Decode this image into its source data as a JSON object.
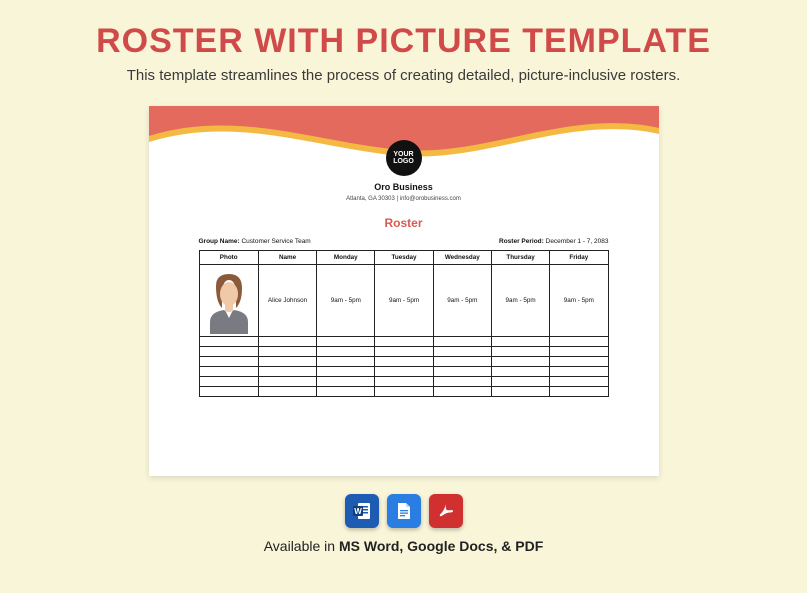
{
  "header": {
    "title": "ROSTER WITH PICTURE TEMPLATE",
    "subtitle": "This template streamlines the process of creating detailed, picture-inclusive rosters."
  },
  "document": {
    "logo_text": "YOUR LOGO",
    "business_name": "Oro Business",
    "address_line": "Atlanta, GA 30303 | info@orobusiness.com",
    "roster_heading": "Roster",
    "group_label": "Group Name:",
    "group_value": "Customer Service Team",
    "period_label": "Roster Period:",
    "period_value": "December 1 - 7, 2083",
    "columns": [
      "Photo",
      "Name",
      "Monday",
      "Tuesday",
      "Wednesday",
      "Thursday",
      "Friday"
    ],
    "rows": [
      {
        "name": "Alice Johnson",
        "mon": "9am - 5pm",
        "tue": "9am - 5pm",
        "wed": "9am - 5pm",
        "thu": "9am - 5pm",
        "fri": "9am - 5pm"
      }
    ]
  },
  "footer": {
    "available_prefix": "Available in ",
    "available_bold": "MS Word, Google Docs, & PDF"
  }
}
